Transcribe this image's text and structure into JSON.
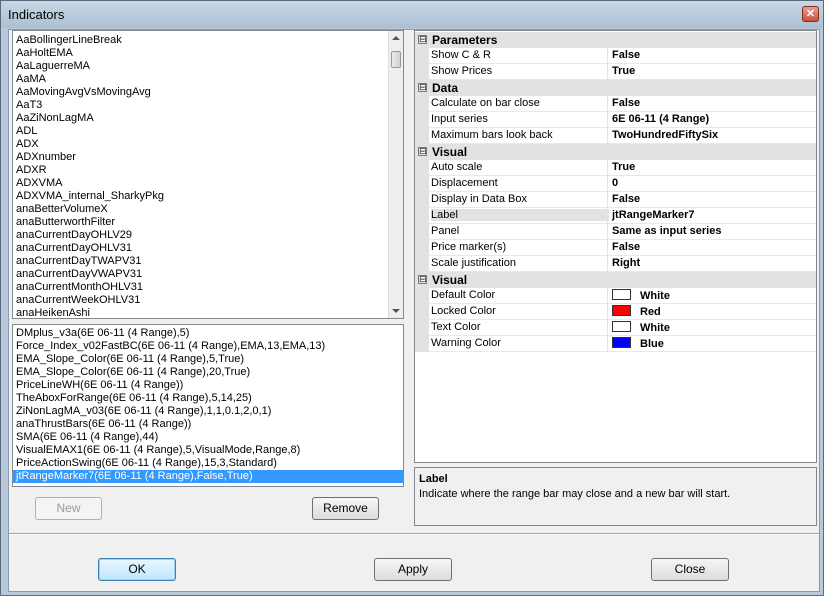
{
  "window": {
    "title": "Indicators",
    "close_glyph": "✕"
  },
  "available_list": [
    "AaBollingerLineBreak",
    "AaHoltEMA",
    "AaLaguerreMA",
    "AaMA",
    "AaMovingAvgVsMovingAvg",
    "AaT3",
    "AaZiNonLagMA",
    "ADL",
    "ADX",
    "ADXnumber",
    "ADXR",
    "ADXVMA",
    "ADXVMA_internal_SharkyPkg",
    "anaBetterVolumeX",
    "anaButterworthFilter",
    "anaCurrentDayOHLV29",
    "anaCurrentDayOHLV31",
    "anaCurrentDayTWAPV31",
    "anaCurrentDayVWAPV31",
    "anaCurrentMonthOHLV31",
    "anaCurrentWeekOHLV31",
    "anaHeikenAshi"
  ],
  "applied_list": [
    "DMplus_v3a(6E 06-11 (4 Range),5)",
    "Force_Index_v02FastBC(6E 06-11 (4 Range),EMA,13,EMA,13)",
    "EMA_Slope_Color(6E 06-11 (4 Range),5,True)",
    "EMA_Slope_Color(6E 06-11 (4 Range),20,True)",
    "PriceLineWH(6E 06-11 (4 Range))",
    "TheAboxForRange(6E 06-11 (4 Range),5,14,25)",
    "ZiNonLagMA_v03(6E 06-11 (4 Range),1,1,0.1,2,0,1)",
    "anaThrustBars(6E 06-11 (4 Range))",
    "SMA(6E 06-11 (4 Range),44)",
    "VisualEMAX1(6E 06-11 (4 Range),5,VisualMode,Range,8)",
    "PriceActionSwing(6E 06-11 (4 Range),15,3,Standard)",
    "jtRangeMarker7(6E 06-11 (4 Range),False,True)"
  ],
  "applied_selected_index": 11,
  "buttons": {
    "new": "New",
    "remove": "Remove",
    "ok": "OK",
    "apply": "Apply",
    "close": "Close"
  },
  "properties": {
    "collapse_glyph": "⊟",
    "categories": [
      {
        "name": "Parameters",
        "rows": [
          {
            "name": "Show C & R",
            "value": "False"
          },
          {
            "name": "Show Prices",
            "value": "True"
          }
        ]
      },
      {
        "name": "Data",
        "rows": [
          {
            "name": "Calculate on bar close",
            "value": "False"
          },
          {
            "name": "Input series",
            "value": "6E 06-11 (4 Range)"
          },
          {
            "name": "Maximum bars look back",
            "value": "TwoHundredFiftySix"
          }
        ]
      },
      {
        "name": "Visual",
        "rows": [
          {
            "name": "Auto scale",
            "value": "True"
          },
          {
            "name": "Displacement",
            "value": "0"
          },
          {
            "name": "Display in Data Box",
            "value": "False"
          },
          {
            "name": "Label",
            "value": "jtRangeMarker7"
          },
          {
            "name": "Panel",
            "value": "Same as input series"
          },
          {
            "name": "Price marker(s)",
            "value": "False"
          },
          {
            "name": "Scale justification",
            "value": "Right"
          }
        ]
      },
      {
        "name": "Visual",
        "rows": [
          {
            "name": "Default Color",
            "value": "White",
            "color": "#ffffff"
          },
          {
            "name": "Locked Color",
            "value": "Red",
            "color": "#ff0000"
          },
          {
            "name": "Text Color",
            "value": "White",
            "color": "#ffffff"
          },
          {
            "name": "Warning Color",
            "value": "Blue",
            "color": "#0000ff"
          }
        ]
      }
    ],
    "selected_row": "Label"
  },
  "description": {
    "title": "Label",
    "text": "Indicate where the range bar may close and a new bar will start."
  }
}
